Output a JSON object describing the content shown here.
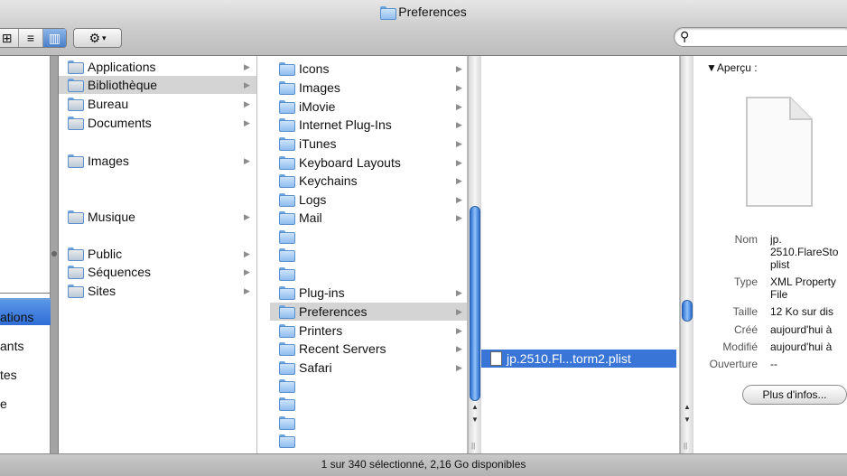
{
  "window": {
    "title": "Preferences"
  },
  "toolbar": {
    "view_icons_glyph": "⊞",
    "view_list_glyph": "≡",
    "view_columns_glyph": "▥",
    "action_glyph": "⚙",
    "action_caret": "▾",
    "search_glyph": "⚲",
    "search_value": ""
  },
  "sidebar": {
    "items": [
      "ations",
      "ants",
      "tes",
      "e"
    ]
  },
  "columns": {
    "col1": [
      {
        "label": "Applications",
        "arrow": "▶"
      },
      {
        "label": "Bibliothèque",
        "arrow": "▶"
      },
      {
        "label": "Bureau",
        "arrow": "▶"
      },
      {
        "label": "Documents",
        "arrow": "▶"
      },
      {
        "label": "Images",
        "arrow": "▶"
      },
      {
        "label": "Musique",
        "arrow": "▶"
      },
      {
        "label": "Public",
        "arrow": "▶"
      },
      {
        "label": "Séquences",
        "arrow": "▶"
      },
      {
        "label": "Sites",
        "arrow": "▶"
      }
    ],
    "col2": [
      {
        "label": "Icons",
        "arrow": "▶"
      },
      {
        "label": "Images",
        "arrow": "▶"
      },
      {
        "label": "iMovie",
        "arrow": "▶"
      },
      {
        "label": "Internet Plug-Ins",
        "arrow": "▶"
      },
      {
        "label": "iTunes",
        "arrow": "▶"
      },
      {
        "label": "Keyboard Layouts",
        "arrow": "▶"
      },
      {
        "label": "Keychains",
        "arrow": "▶"
      },
      {
        "label": "Logs",
        "arrow": "▶"
      },
      {
        "label": "Mail",
        "arrow": "▶"
      },
      {
        "label": "Plug-ins",
        "arrow": "▶"
      },
      {
        "label": "Preferences",
        "arrow": "▶"
      },
      {
        "label": "Printers",
        "arrow": "▶"
      },
      {
        "label": "Recent Servers",
        "arrow": "▶"
      },
      {
        "label": "Safari",
        "arrow": "▶"
      }
    ],
    "col3": [
      {
        "label": "jp.2510.Fl...torm2.plist"
      }
    ]
  },
  "preview": {
    "heading": "▼Aperçu :",
    "name_label": "Nom",
    "name_value": "jp.\n2510.FlareSto\nplist",
    "type_label": "Type",
    "type_value": "XML Property\nFile",
    "size_label": "Taille",
    "size_value": "12 Ko sur dis",
    "created_label": "Créé",
    "created_value": "aujourd'hui à",
    "modified_label": "Modifié",
    "modified_value": "aujourd'hui à",
    "opened_label": "Ouverture",
    "opened_value": "--",
    "more_info_label": "Plus d'infos..."
  },
  "status": {
    "text": "1 sur 340 sélectionné, 2,16 Go disponibles"
  },
  "colors": {
    "selection_blue": "#3875d7",
    "selection_gray": "#d4d4d4"
  }
}
